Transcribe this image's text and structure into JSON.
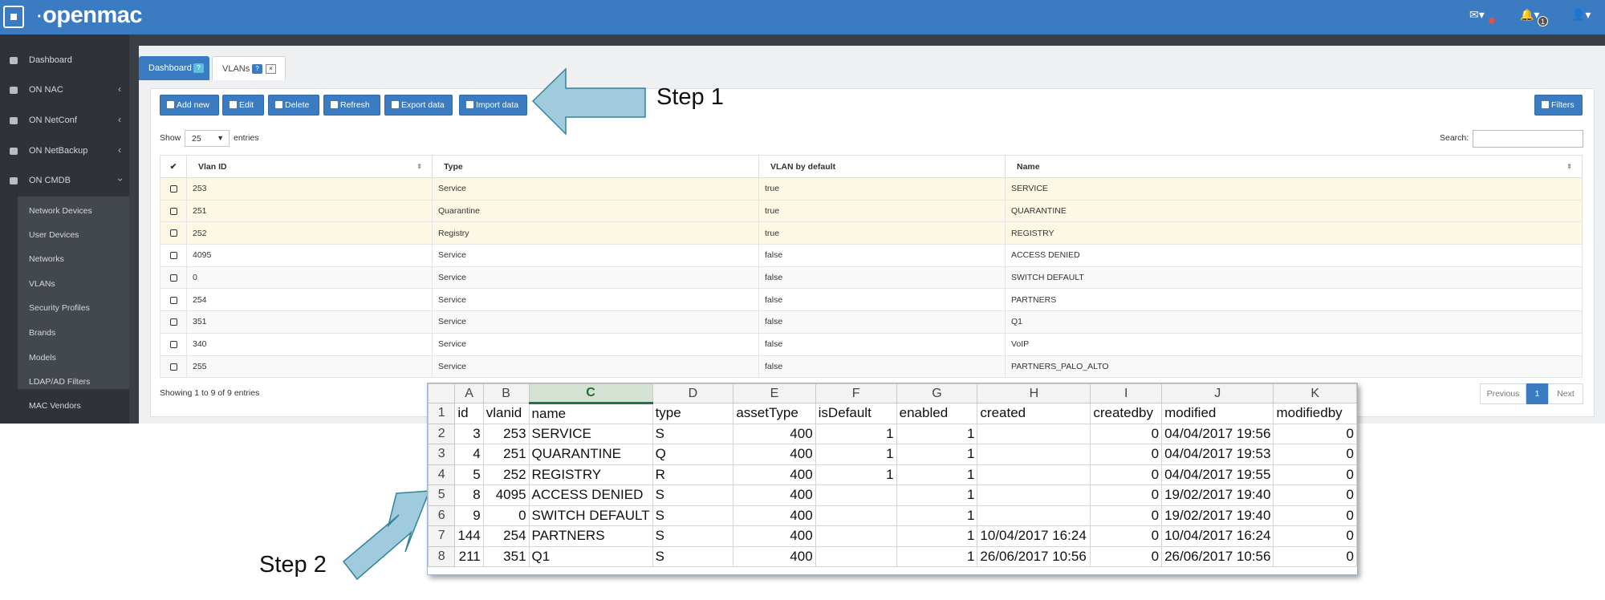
{
  "header": {
    "logo": "openmac",
    "notification_count": "1"
  },
  "sidebar": {
    "items": [
      {
        "label": "Dashboard",
        "icon": "dashboard-icon"
      },
      {
        "label": "ON NAC",
        "icon": "graduation-icon"
      },
      {
        "label": "ON NetConf",
        "icon": "list-icon"
      },
      {
        "label": "ON NetBackup",
        "icon": "database-icon"
      },
      {
        "label": "ON CMDB",
        "icon": "table-icon"
      }
    ],
    "submenu": [
      "Network Devices",
      "User Devices",
      "Networks",
      "VLANs",
      "Security Profiles",
      "Brands",
      "Models",
      "LDAP/AD Filters",
      "MAC Vendors"
    ]
  },
  "tabs": [
    {
      "label": "Dashboard"
    },
    {
      "label": "VLANs"
    }
  ],
  "tab_badge": "?",
  "tab_close": "×",
  "toolbar": {
    "add": "Add new",
    "edit": "Edit",
    "delete": "Delete",
    "refresh": "Refresh",
    "export": "Export data",
    "import": "Import data",
    "filters": "Filters"
  },
  "table_controls": {
    "show": "Show",
    "entries_value": "25",
    "entries_arrow": "▼",
    "entries": "entries",
    "search": "Search:"
  },
  "vlan_table": {
    "check_header": "✔",
    "columns": [
      "Vlan ID",
      "Type",
      "VLAN by default",
      "Name"
    ],
    "rows": [
      [
        "253",
        "Service",
        "true",
        "SERVICE"
      ],
      [
        "251",
        "Quarantine",
        "true",
        "QUARANTINE"
      ],
      [
        "252",
        "Registry",
        "true",
        "REGISTRY"
      ],
      [
        "4095",
        "Service",
        "false",
        "ACCESS DENIED"
      ],
      [
        "0",
        "Service",
        "false",
        "SWITCH DEFAULT"
      ],
      [
        "254",
        "Service",
        "false",
        "PARTNERS"
      ],
      [
        "351",
        "Service",
        "false",
        "Q1"
      ],
      [
        "340",
        "Service",
        "false",
        "VoIP"
      ],
      [
        "255",
        "Service",
        "false",
        "PARTNERS_PALO_ALTO"
      ]
    ],
    "footer": "Showing 1 to 9 of 9 entries"
  },
  "pagination": {
    "previous": "Previous",
    "page": "1",
    "next": "Next"
  },
  "annotations": {
    "step1": "Step 1",
    "step2": "Step 2",
    "arrow_color": "#9fcbdc"
  },
  "spreadsheet": {
    "column_letters": [
      "A",
      "B",
      "C",
      "D",
      "E",
      "F",
      "G",
      "H",
      "I",
      "J",
      "K"
    ],
    "selected_column": "C",
    "row_numbers": [
      "1",
      "2",
      "3",
      "4",
      "5",
      "6",
      "7",
      "8"
    ],
    "header_row": [
      "id",
      "vlanid",
      "name",
      "type",
      "assetType",
      "isDefault",
      "enabled",
      "created",
      "createdby",
      "modified",
      "modifiedby"
    ],
    "rows": [
      [
        "3",
        "253",
        "SERVICE",
        "S",
        "400",
        "1",
        "1",
        "",
        "0",
        "04/04/2017 19:56",
        "0"
      ],
      [
        "4",
        "251",
        "QUARANTINE",
        "Q",
        "400",
        "1",
        "1",
        "",
        "0",
        "04/04/2017 19:53",
        "0"
      ],
      [
        "5",
        "252",
        "REGISTRY",
        "R",
        "400",
        "1",
        "1",
        "",
        "0",
        "04/04/2017 19:55",
        "0"
      ],
      [
        "8",
        "4095",
        "ACCESS DENIED",
        "S",
        "400",
        "",
        "1",
        "",
        "0",
        "19/02/2017 19:40",
        "0"
      ],
      [
        "9",
        "0",
        "SWITCH DEFAULT",
        "S",
        "400",
        "",
        "1",
        "",
        "0",
        "19/02/2017 19:40",
        "0"
      ],
      [
        "144",
        "254",
        "PARTNERS",
        "S",
        "400",
        "",
        "1",
        "10/04/2017 16:24",
        "0",
        "10/04/2017 16:24",
        "0"
      ],
      [
        "211",
        "351",
        "Q1",
        "S",
        "400",
        "",
        "1",
        "26/06/2017 10:56",
        "0",
        "26/06/2017 10:56",
        "0"
      ]
    ]
  }
}
